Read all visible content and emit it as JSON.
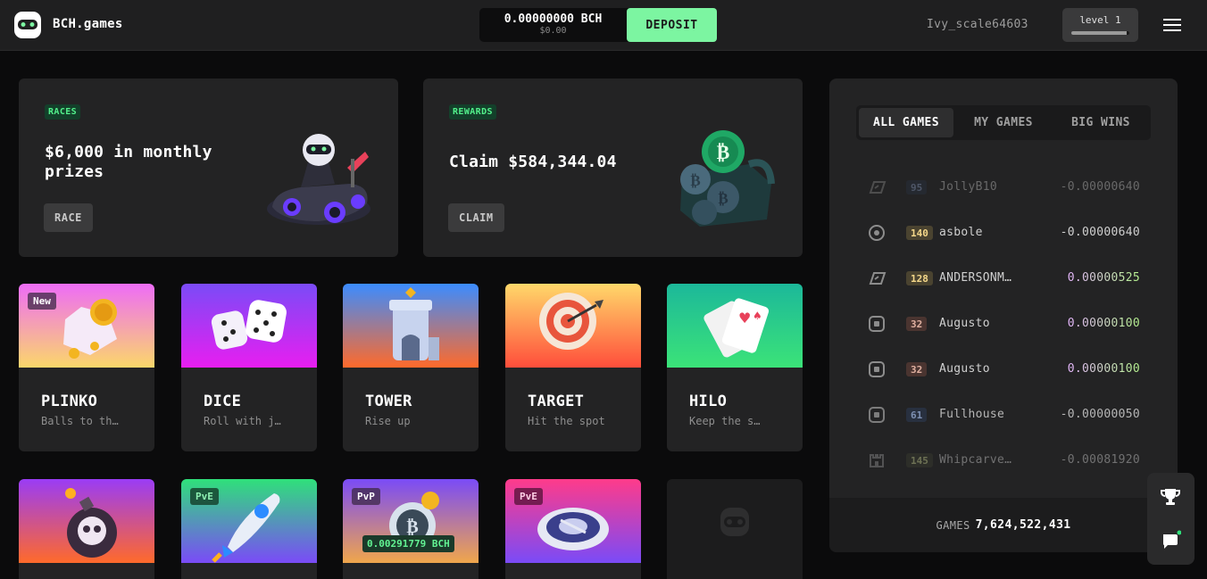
{
  "header": {
    "brand": "BCH.games",
    "balance_bch": "0.00000000 BCH",
    "balance_usd": "$0.00",
    "deposit_label": "DEPOSIT",
    "username": "Ivy_scale64603",
    "level_label": "level 1",
    "level_progress": 0.95
  },
  "promos": [
    {
      "tag": "RACES",
      "title": "$6,000 in monthly prizes",
      "button": "RACE"
    },
    {
      "tag": "REWARDS",
      "title": "Claim $584,344.04",
      "button": "CLAIM"
    }
  ],
  "games": [
    {
      "title": "PLINKO",
      "subtitle": "Balls to th…",
      "badge": "New"
    },
    {
      "title": "DICE",
      "subtitle": "Roll with j…"
    },
    {
      "title": "TOWER",
      "subtitle": "Rise up"
    },
    {
      "title": "TARGET",
      "subtitle": "Hit the spot"
    },
    {
      "title": "HILO",
      "subtitle": "Keep the s…"
    }
  ],
  "games_row2": [
    {
      "badge": ""
    },
    {
      "badge": "PvE"
    },
    {
      "badge": "PvP",
      "prize": "0.00291779 BCH"
    },
    {
      "badge": "PvE"
    },
    {
      "badge": ""
    }
  ],
  "feed": {
    "tabs": [
      "ALL GAMES",
      "MY GAMES",
      "BIG WINS"
    ],
    "active_tab": "ALL GAMES",
    "rows": [
      {
        "icon": "plinko-icon",
        "level": "95",
        "name": "JollyB10",
        "amount": "-0.00000640",
        "win": false
      },
      {
        "icon": "target-icon",
        "level": "140",
        "name": "asbole",
        "amount": "-0.00000640",
        "win": false
      },
      {
        "icon": "plinko-icon",
        "level": "128",
        "name": "ANDERSONM…",
        "amount": "0.00000525",
        "win": true
      },
      {
        "icon": "dice-icon",
        "level": "32",
        "name": "Augusto",
        "amount": "0.00000100",
        "win": true
      },
      {
        "icon": "dice-icon",
        "level": "32",
        "name": "Augusto",
        "amount": "0.00000100",
        "win": true
      },
      {
        "icon": "dice-icon",
        "level": "61",
        "name": "Fullhouse",
        "amount": "-0.00000050",
        "win": false
      },
      {
        "icon": "tower-icon",
        "level": "145",
        "name": "Whipcarve…",
        "amount": "-0.00081920",
        "win": false
      }
    ],
    "games_label": "GAMES",
    "games_count": "7,624,522,431"
  },
  "colors": {
    "accent": "#7cf5a1",
    "win_gradient_start": "#e7b6ff",
    "win_gradient_end": "#b6f58e"
  }
}
